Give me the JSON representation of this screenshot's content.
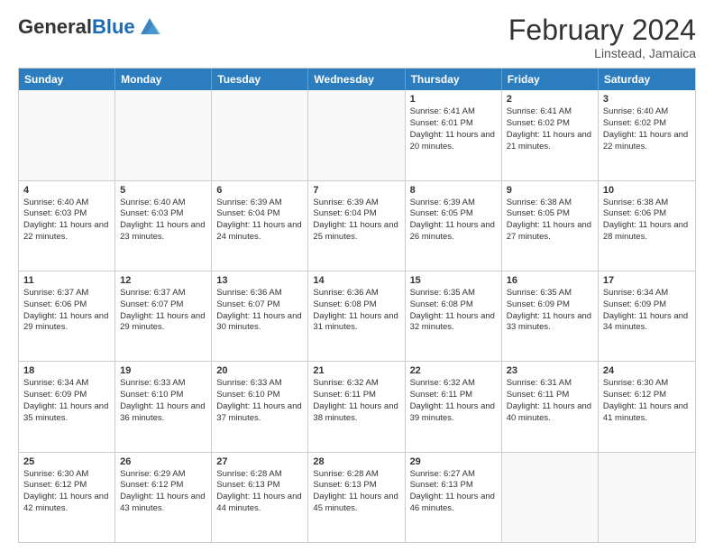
{
  "header": {
    "logo_general": "General",
    "logo_blue": "Blue",
    "month_year": "February 2024",
    "location": "Linstead, Jamaica"
  },
  "days_of_week": [
    "Sunday",
    "Monday",
    "Tuesday",
    "Wednesday",
    "Thursday",
    "Friday",
    "Saturday"
  ],
  "weeks": [
    [
      {
        "day": "",
        "info": ""
      },
      {
        "day": "",
        "info": ""
      },
      {
        "day": "",
        "info": ""
      },
      {
        "day": "",
        "info": ""
      },
      {
        "day": "1",
        "info": "Sunrise: 6:41 AM\nSunset: 6:01 PM\nDaylight: 11 hours and 20 minutes."
      },
      {
        "day": "2",
        "info": "Sunrise: 6:41 AM\nSunset: 6:02 PM\nDaylight: 11 hours and 21 minutes."
      },
      {
        "day": "3",
        "info": "Sunrise: 6:40 AM\nSunset: 6:02 PM\nDaylight: 11 hours and 22 minutes."
      }
    ],
    [
      {
        "day": "4",
        "info": "Sunrise: 6:40 AM\nSunset: 6:03 PM\nDaylight: 11 hours and 22 minutes."
      },
      {
        "day": "5",
        "info": "Sunrise: 6:40 AM\nSunset: 6:03 PM\nDaylight: 11 hours and 23 minutes."
      },
      {
        "day": "6",
        "info": "Sunrise: 6:39 AM\nSunset: 6:04 PM\nDaylight: 11 hours and 24 minutes."
      },
      {
        "day": "7",
        "info": "Sunrise: 6:39 AM\nSunset: 6:04 PM\nDaylight: 11 hours and 25 minutes."
      },
      {
        "day": "8",
        "info": "Sunrise: 6:39 AM\nSunset: 6:05 PM\nDaylight: 11 hours and 26 minutes."
      },
      {
        "day": "9",
        "info": "Sunrise: 6:38 AM\nSunset: 6:05 PM\nDaylight: 11 hours and 27 minutes."
      },
      {
        "day": "10",
        "info": "Sunrise: 6:38 AM\nSunset: 6:06 PM\nDaylight: 11 hours and 28 minutes."
      }
    ],
    [
      {
        "day": "11",
        "info": "Sunrise: 6:37 AM\nSunset: 6:06 PM\nDaylight: 11 hours and 29 minutes."
      },
      {
        "day": "12",
        "info": "Sunrise: 6:37 AM\nSunset: 6:07 PM\nDaylight: 11 hours and 29 minutes."
      },
      {
        "day": "13",
        "info": "Sunrise: 6:36 AM\nSunset: 6:07 PM\nDaylight: 11 hours and 30 minutes."
      },
      {
        "day": "14",
        "info": "Sunrise: 6:36 AM\nSunset: 6:08 PM\nDaylight: 11 hours and 31 minutes."
      },
      {
        "day": "15",
        "info": "Sunrise: 6:35 AM\nSunset: 6:08 PM\nDaylight: 11 hours and 32 minutes."
      },
      {
        "day": "16",
        "info": "Sunrise: 6:35 AM\nSunset: 6:09 PM\nDaylight: 11 hours and 33 minutes."
      },
      {
        "day": "17",
        "info": "Sunrise: 6:34 AM\nSunset: 6:09 PM\nDaylight: 11 hours and 34 minutes."
      }
    ],
    [
      {
        "day": "18",
        "info": "Sunrise: 6:34 AM\nSunset: 6:09 PM\nDaylight: 11 hours and 35 minutes."
      },
      {
        "day": "19",
        "info": "Sunrise: 6:33 AM\nSunset: 6:10 PM\nDaylight: 11 hours and 36 minutes."
      },
      {
        "day": "20",
        "info": "Sunrise: 6:33 AM\nSunset: 6:10 PM\nDaylight: 11 hours and 37 minutes."
      },
      {
        "day": "21",
        "info": "Sunrise: 6:32 AM\nSunset: 6:11 PM\nDaylight: 11 hours and 38 minutes."
      },
      {
        "day": "22",
        "info": "Sunrise: 6:32 AM\nSunset: 6:11 PM\nDaylight: 11 hours and 39 minutes."
      },
      {
        "day": "23",
        "info": "Sunrise: 6:31 AM\nSunset: 6:11 PM\nDaylight: 11 hours and 40 minutes."
      },
      {
        "day": "24",
        "info": "Sunrise: 6:30 AM\nSunset: 6:12 PM\nDaylight: 11 hours and 41 minutes."
      }
    ],
    [
      {
        "day": "25",
        "info": "Sunrise: 6:30 AM\nSunset: 6:12 PM\nDaylight: 11 hours and 42 minutes."
      },
      {
        "day": "26",
        "info": "Sunrise: 6:29 AM\nSunset: 6:12 PM\nDaylight: 11 hours and 43 minutes."
      },
      {
        "day": "27",
        "info": "Sunrise: 6:28 AM\nSunset: 6:13 PM\nDaylight: 11 hours and 44 minutes."
      },
      {
        "day": "28",
        "info": "Sunrise: 6:28 AM\nSunset: 6:13 PM\nDaylight: 11 hours and 45 minutes."
      },
      {
        "day": "29",
        "info": "Sunrise: 6:27 AM\nSunset: 6:13 PM\nDaylight: 11 hours and 46 minutes."
      },
      {
        "day": "",
        "info": ""
      },
      {
        "day": "",
        "info": ""
      }
    ]
  ]
}
